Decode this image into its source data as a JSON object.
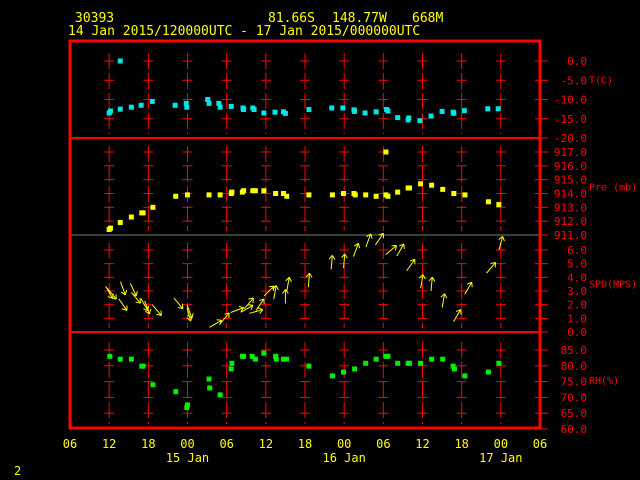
{
  "header": {
    "station_id": "30393",
    "latitude": "81.66S",
    "longitude": "148.77W",
    "elevation": "668M",
    "time_range": "14 Jan 2015/120000UTC - 17 Jan 2015/000000UTC"
  },
  "page_number": "2",
  "colors": {
    "frame": "#ff0000",
    "temperature": "#00e5e5",
    "pressure": "#ffff00",
    "wind": "#ffff00",
    "rh": "#00ee00",
    "axis_text": "#ff0000",
    "time_text": "#ffff00"
  },
  "chart_data": {
    "type": "scatter",
    "x_unit": "hours since 14 Jan 2015 06 UTC",
    "xlim": [
      0,
      72
    ],
    "x_ticks": [
      {
        "h": 0,
        "label": "06"
      },
      {
        "h": 6,
        "label": "12"
      },
      {
        "h": 12,
        "label": "18"
      },
      {
        "h": 18,
        "label": "00"
      },
      {
        "h": 24,
        "label": "06"
      },
      {
        "h": 30,
        "label": "12"
      },
      {
        "h": 36,
        "label": "18"
      },
      {
        "h": 42,
        "label": "00"
      },
      {
        "h": 48,
        "label": "06"
      },
      {
        "h": 54,
        "label": "12"
      },
      {
        "h": 60,
        "label": "18"
      },
      {
        "h": 66,
        "label": "00"
      },
      {
        "h": 72,
        "label": "06"
      }
    ],
    "date_labels": [
      {
        "h": 18,
        "label": "15 Jan"
      },
      {
        "h": 42,
        "label": "16 Jan"
      },
      {
        "h": 66,
        "label": "17 Jan"
      }
    ],
    "panels": [
      {
        "name": "temperature",
        "label": "T(C)",
        "ylim": [
          -20,
          0
        ],
        "ticks": [
          "0.0",
          "-5.0",
          "-10.0",
          "-15.0",
          "-20.0"
        ],
        "tick_values": [
          0,
          -5,
          -10,
          -15,
          -20
        ],
        "points": [
          [
            6.0,
            -13.5
          ],
          [
            6.2,
            -13
          ],
          [
            7.7,
            -12.5
          ],
          [
            9.4,
            -12
          ],
          [
            10.9,
            -11.5
          ],
          [
            12.6,
            -10.5
          ],
          [
            7.7,
            0.0
          ],
          [
            16.1,
            -11.5
          ],
          [
            17.8,
            -11
          ],
          [
            17.9,
            -12
          ],
          [
            21.1,
            -10
          ],
          [
            21.3,
            -11
          ],
          [
            22.8,
            -11
          ],
          [
            23,
            -12
          ],
          [
            24.7,
            -11.8
          ],
          [
            26.5,
            -12.2
          ],
          [
            26.6,
            -12.6
          ],
          [
            28,
            -12.2
          ],
          [
            28.2,
            -12.6
          ],
          [
            29.7,
            -13.5
          ],
          [
            31.4,
            -13.3
          ],
          [
            32.7,
            -13.2
          ],
          [
            33,
            -13.6
          ],
          [
            36.6,
            -12.6
          ],
          [
            40.1,
            -12.2
          ],
          [
            41.8,
            -12.2
          ],
          [
            43.5,
            -12.7
          ],
          [
            43.6,
            -13.1
          ],
          [
            45.2,
            -13.5
          ],
          [
            46.9,
            -13.2
          ],
          [
            48.5,
            -12.6
          ],
          [
            48.7,
            -13
          ],
          [
            50.2,
            -14.7
          ],
          [
            51.8,
            -15.3
          ],
          [
            51.9,
            -14.8
          ],
          [
            53.6,
            -15.5
          ],
          [
            55.3,
            -14.3
          ],
          [
            57,
            -13.1
          ],
          [
            58.7,
            -13.3
          ],
          [
            58.8,
            -13.6
          ],
          [
            60.4,
            -12.9
          ],
          [
            64.0,
            -12.4
          ],
          [
            65.6,
            -12.4
          ]
        ]
      },
      {
        "name": "pressure",
        "label": "Pre (mb)",
        "ylim": [
          911,
          917.8
        ],
        "ticks": [
          "917.0",
          "916.0",
          "915.0",
          "914.0",
          "913.0",
          "912.0",
          "911.0"
        ],
        "tick_values": [
          917,
          916,
          915,
          914,
          913,
          912,
          911
        ],
        "points": [
          [
            6.0,
            911.4
          ],
          [
            6.2,
            911.5
          ],
          [
            7.7,
            911.9
          ],
          [
            9.4,
            912.3
          ],
          [
            11.0,
            912.6
          ],
          [
            11.2,
            912.6
          ],
          [
            12.7,
            913.0
          ],
          [
            16.2,
            913.8
          ],
          [
            18.0,
            913.9
          ],
          [
            21.3,
            913.9
          ],
          [
            23.0,
            913.9
          ],
          [
            24.7,
            914.0
          ],
          [
            24.8,
            914.1
          ],
          [
            26.4,
            914.1
          ],
          [
            26.6,
            914.2
          ],
          [
            28.0,
            914.2
          ],
          [
            28.4,
            914.2
          ],
          [
            29.7,
            914.2
          ],
          [
            31.5,
            914.0
          ],
          [
            32.7,
            914.0
          ],
          [
            33.2,
            913.8
          ],
          [
            36.6,
            913.9
          ],
          [
            40.2,
            913.9
          ],
          [
            41.9,
            914.0
          ],
          [
            43.5,
            914.0
          ],
          [
            43.7,
            913.9
          ],
          [
            45.3,
            913.9
          ],
          [
            46.9,
            913.8
          ],
          [
            48.4,
            913.9
          ],
          [
            48.7,
            913.8
          ],
          [
            48.4,
            917.0
          ],
          [
            50.2,
            914.1
          ],
          [
            51.8,
            914.4
          ],
          [
            52.0,
            914.4
          ],
          [
            53.7,
            914.7
          ],
          [
            55.4,
            914.6
          ],
          [
            57.1,
            914.3
          ],
          [
            58.8,
            914.0
          ],
          [
            60.5,
            913.9
          ],
          [
            64.1,
            913.4
          ],
          [
            65.7,
            913.2
          ]
        ]
      },
      {
        "name": "wind_speed",
        "label": "SPD(MPS)",
        "ylim": [
          0,
          7
        ],
        "ticks": [
          "6.0",
          "5.0",
          "4.0",
          "3.0",
          "2.0",
          "1.0",
          "0.0"
        ],
        "tick_values": [
          6,
          5,
          4,
          3,
          2,
          1,
          0
        ],
        "points_note": "[hour, speed, arrow heading deg (0=up, clockwise)]",
        "points": [
          [
            6.0,
            2.9,
            150
          ],
          [
            6.4,
            2.8,
            140
          ],
          [
            8.1,
            3.2,
            160
          ],
          [
            8.1,
            2.0,
            145
          ],
          [
            9.7,
            3.1,
            155
          ],
          [
            10.1,
            2.5,
            140
          ],
          [
            11.4,
            2.0,
            150
          ],
          [
            11.8,
            1.8,
            160
          ],
          [
            13.3,
            1.6,
            140
          ],
          [
            16.6,
            2.1,
            140
          ],
          [
            18.2,
            1.3,
            165
          ],
          [
            18.3,
            1.5,
            160
          ],
          [
            22.3,
            0.6,
            60
          ],
          [
            23.7,
            1.0,
            40
          ],
          [
            25.6,
            1.6,
            70
          ],
          [
            27.1,
            1.7,
            60
          ],
          [
            27.4,
            2.1,
            40
          ],
          [
            28.5,
            1.5,
            75
          ],
          [
            29.1,
            2.0,
            35
          ],
          [
            30.5,
            3.0,
            45
          ],
          [
            31.4,
            2.9,
            10
          ],
          [
            33.0,
            2.6,
            0
          ],
          [
            33.4,
            3.5,
            10
          ],
          [
            36.6,
            3.8,
            5
          ],
          [
            40.1,
            5.1,
            5
          ],
          [
            42.0,
            5.2,
            5
          ],
          [
            43.8,
            6.0,
            20
          ],
          [
            45.7,
            6.7,
            20
          ],
          [
            47.4,
            6.8,
            35
          ],
          [
            49.2,
            6.0,
            50
          ],
          [
            50.6,
            6.0,
            30
          ],
          [
            52.2,
            4.9,
            35
          ],
          [
            53.9,
            3.7,
            10
          ],
          [
            55.4,
            3.5,
            5
          ],
          [
            57.2,
            2.3,
            10
          ],
          [
            59.3,
            1.2,
            30
          ],
          [
            61.0,
            3.2,
            30
          ],
          [
            64.5,
            4.7,
            40
          ],
          [
            66.0,
            6.5,
            15
          ]
        ]
      },
      {
        "name": "relative_humidity",
        "label": "RH(%)",
        "ylim": [
          60,
          87
        ],
        "ticks": [
          "85.0",
          "80.0",
          "75.0",
          "70.0",
          "65.0",
          "60.0"
        ],
        "tick_values": [
          85,
          80,
          75,
          70,
          65,
          60
        ],
        "points": [
          [
            6.1,
            83.0
          ],
          [
            7.7,
            82.1
          ],
          [
            9.4,
            82.1
          ],
          [
            11.0,
            79.9
          ],
          [
            11.2,
            79.9
          ],
          [
            12.7,
            74.0
          ],
          [
            16.2,
            71.8
          ],
          [
            17.9,
            66.8
          ],
          [
            18.0,
            67.6
          ],
          [
            21.3,
            75.8
          ],
          [
            21.4,
            73.0
          ],
          [
            23.0,
            70.8
          ],
          [
            24.7,
            79.0
          ],
          [
            24.8,
            80.8
          ],
          [
            26.4,
            83.0
          ],
          [
            26.6,
            83.0
          ],
          [
            27.9,
            83.0
          ],
          [
            28.4,
            82.1
          ],
          [
            29.7,
            84.0
          ],
          [
            31.5,
            83.0
          ],
          [
            31.6,
            82.1
          ],
          [
            32.7,
            82.1
          ],
          [
            33.2,
            82.1
          ],
          [
            36.6,
            79.9
          ],
          [
            40.2,
            76.8
          ],
          [
            41.9,
            78.0
          ],
          [
            43.6,
            79.0
          ],
          [
            45.3,
            80.8
          ],
          [
            46.9,
            82.1
          ],
          [
            48.4,
            83.0
          ],
          [
            48.7,
            83.0
          ],
          [
            50.2,
            80.8
          ],
          [
            51.8,
            80.8
          ],
          [
            52.0,
            80.8
          ],
          [
            53.7,
            80.8
          ],
          [
            55.4,
            82.1
          ],
          [
            57.1,
            82.1
          ],
          [
            58.7,
            79.9
          ],
          [
            58.9,
            79.0
          ],
          [
            60.5,
            76.8
          ],
          [
            64.1,
            78.0
          ],
          [
            65.7,
            80.8
          ]
        ]
      }
    ]
  }
}
